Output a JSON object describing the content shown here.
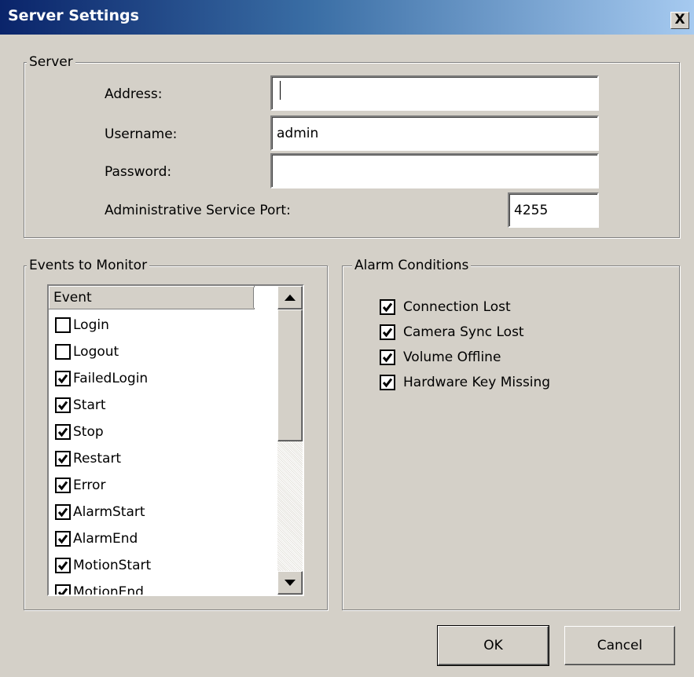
{
  "window": {
    "title": "Server Settings",
    "close_label": "X"
  },
  "server": {
    "legend": "Server",
    "address": {
      "label": "Address:",
      "value": ""
    },
    "username": {
      "label": "Username:",
      "value": "admin"
    },
    "password": {
      "label": "Password:",
      "value": ""
    },
    "port": {
      "label": "Administrative Service Port:",
      "value": "4255"
    }
  },
  "events": {
    "legend": "Events to Monitor",
    "column_header": "Event",
    "items": [
      {
        "label": "Login",
        "checked": false
      },
      {
        "label": "Logout",
        "checked": false
      },
      {
        "label": "FailedLogin",
        "checked": true
      },
      {
        "label": "Start",
        "checked": true
      },
      {
        "label": "Stop",
        "checked": true
      },
      {
        "label": "Restart",
        "checked": true
      },
      {
        "label": "Error",
        "checked": true
      },
      {
        "label": "AlarmStart",
        "checked": true
      },
      {
        "label": "AlarmEnd",
        "checked": true
      },
      {
        "label": "MotionStart",
        "checked": true
      },
      {
        "label": "MotionEnd",
        "checked": true
      }
    ]
  },
  "alarms": {
    "legend": "Alarm Conditions",
    "items": [
      {
        "label": "Connection Lost",
        "checked": true
      },
      {
        "label": "Camera Sync Lost",
        "checked": true
      },
      {
        "label": "Volume Offline",
        "checked": true
      },
      {
        "label": "Hardware Key Missing",
        "checked": true
      }
    ]
  },
  "buttons": {
    "ok": "OK",
    "cancel": "Cancel"
  },
  "colors": {
    "title_start": "#0a246a",
    "title_end": "#a6caf0",
    "face": "#d4d0c8"
  }
}
